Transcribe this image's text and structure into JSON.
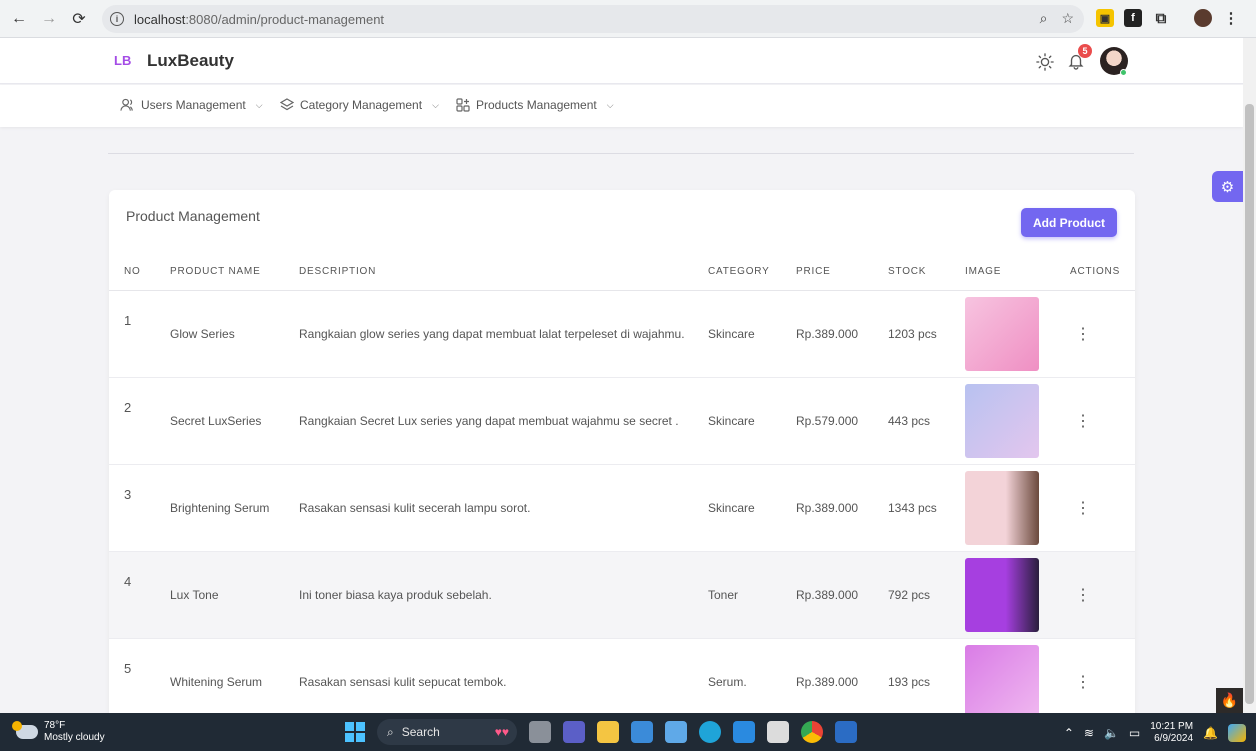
{
  "browser": {
    "url_host": "localhost",
    "url_path": ":8080/admin/product-management"
  },
  "header": {
    "logo_mark": "LB",
    "brand": "LuxBeauty",
    "notification_count": "5"
  },
  "menu": [
    {
      "label": "Users Management",
      "icon": "users-icon"
    },
    {
      "label": "Category Management",
      "icon": "layers-icon"
    },
    {
      "label": "Products Management",
      "icon": "grid-plus-icon"
    }
  ],
  "card": {
    "title": "Product Management",
    "add_button": "Add Product"
  },
  "table": {
    "headers": [
      "NO",
      "PRODUCT NAME",
      "DESCRIPTION",
      "CATEGORY",
      "PRICE",
      "STOCK",
      "IMAGE",
      "ACTIONS"
    ],
    "rows": [
      {
        "no": "1",
        "name": "Glow Series",
        "description": "Rangkaian glow series yang dapat membuat lalat terpeleset di wajahmu.",
        "category": "Skincare",
        "price": "Rp.389.000",
        "stock": "1203 pcs",
        "image_color": "#f4a8d0"
      },
      {
        "no": "2",
        "name": "Secret LuxSeries",
        "description": "Rangkaian Secret Lux series yang dapat membuat wajahmu se secret .",
        "category": "Skincare",
        "price": "Rp.579.000",
        "stock": "443 pcs",
        "image_color": "#c9c4ef"
      },
      {
        "no": "3",
        "name": "Brightening Serum",
        "description": "Rasakan sensasi kulit secerah lampu sorot.",
        "category": "Skincare",
        "price": "Rp.389.000",
        "stock": "1343 pcs",
        "image_color": "#e9c0c8"
      },
      {
        "no": "4",
        "name": "Lux Tone",
        "description": "Ini toner biasa kaya produk sebelah.",
        "category": "Toner",
        "price": "Rp.389.000",
        "stock": "792 pcs",
        "image_color": "#9a2fd0"
      },
      {
        "no": "5",
        "name": "Whitening Serum",
        "description": "Rasakan sensasi kulit sepucat tembok.",
        "category": "Serum.",
        "price": "Rp.389.000",
        "stock": "193 pcs",
        "image_color": "#d58be6"
      }
    ]
  },
  "taskbar": {
    "temp": "78°F",
    "weather": "Mostly cloudy",
    "search": "Search",
    "time": "10:21 PM",
    "date": "6/9/2024"
  }
}
